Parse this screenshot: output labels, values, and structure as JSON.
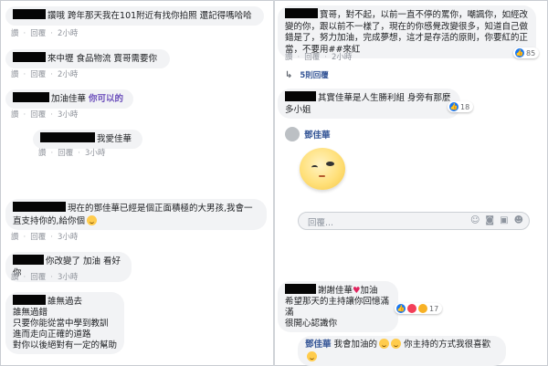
{
  "left": {
    "c1": {
      "text": "讚哦 跨年那天我在101附近有找你拍照 還記得嗎哈哈",
      "reply": "回覆",
      "time": "2小時",
      "like": "讚"
    },
    "c2": {
      "text": "來中壢      食品物流  寶哥需要你",
      "reply": "回覆",
      "time": "2小時",
      "like": "讚"
    },
    "c3": {
      "text": "加油佳華",
      "tag": "你可以的",
      "reply": "回覆",
      "time": "3小時",
      "like": "讚"
    },
    "c4": {
      "text": "我愛佳華",
      "reply": "回覆",
      "time": "3小時",
      "like": "讚"
    },
    "c5": {
      "text": "現在的鄧佳華已經是個正面積極的大男孩,我會一直支持你的,給你個",
      "reply": "回覆",
      "time": "3小時",
      "like": "讚"
    },
    "c6": {
      "text": "你改變了 加油 看好你",
      "reply": "回覆",
      "time": "3小時",
      "like": "讚"
    },
    "c7": {
      "line1": "誰無過去",
      "line2": "誰無過錯",
      "line3": "只要你能從當中學到教訓",
      "line4": "進而走向正確的道路",
      "line5": "對你以後絕對有一定的幫助"
    }
  },
  "right": {
    "c1": {
      "line1": "寶哥，對不起，以前一直不停的罵你，嘲諷你，如經改變的你，跟以前不一樣了，現在的你感覺改變很多，知道自己做錯是了，努力加油，完成夢想，這才是存活的原則，你要紅的正當，不要用##來紅",
      "like": "讚",
      "reply": "回覆",
      "time": "2小時",
      "reactions": "85"
    },
    "view_replies": "5則回覆",
    "c2": {
      "text": "其實佳華是人生勝利組 身旁有那麼多小姐",
      "reactions": "18"
    },
    "c3": {
      "name": "鄧佳華"
    },
    "comment_box": {
      "placeholder": "回覆..."
    },
    "c4": {
      "line1": "謝謝佳華",
      "line1b": "加油",
      "line2": "希望那天的主持讓你回憶滿滿",
      "line3": "很開心認識你",
      "reactions": "17"
    },
    "c5": {
      "name": "鄧佳華",
      "text": "我會加油的",
      "text2": "你主持的方式我很喜歡"
    }
  },
  "colors": {
    "link": "#385898",
    "bubble": "#f2f3f5",
    "like_blue": "#1877f2",
    "meta": "#90949c"
  },
  "icons": [
    "reply-arrow-icon",
    "like-reaction-icon",
    "heart-reaction-icon",
    "haha-reaction-icon",
    "emoji-icon",
    "camera-icon",
    "gif-icon",
    "sticker-icon"
  ]
}
